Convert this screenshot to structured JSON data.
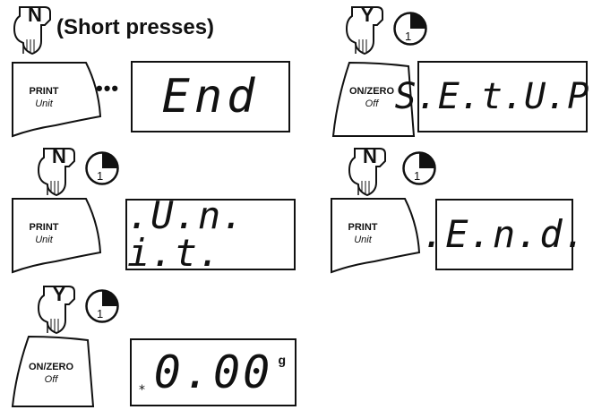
{
  "intro": {
    "key": "N",
    "caption": "(Short presses)",
    "ellipsis": "•••"
  },
  "steps": {
    "end_first": {
      "button_line1": "PRINT",
      "button_line2": "Unit",
      "display": "End"
    },
    "setup": {
      "key": "Y",
      "timer": "1",
      "button_line1": "ON/ZERO",
      "button_line2": "Off",
      "display": "S.E.t.U.P."
    },
    "unit": {
      "key": "N",
      "timer": "1",
      "button_line1": "PRINT",
      "button_line2": "Unit",
      "display": ".U.n. i.t."
    },
    "end_second": {
      "key": "N",
      "timer": "1",
      "button_line1": "PRINT",
      "button_line2": "Unit",
      "display": ".E.n.d."
    },
    "zero": {
      "key": "Y",
      "timer": "1",
      "button_line1": "ON/ZERO",
      "button_line2": "Off",
      "display": "0.00",
      "unit": "g",
      "stable_symbol": "*"
    }
  },
  "colors": {
    "ink": "#111111",
    "background": "#ffffff"
  },
  "icons": {
    "hand": "pointing-hand-icon",
    "timer": "timer-icon",
    "stable": "asterisk-icon"
  }
}
